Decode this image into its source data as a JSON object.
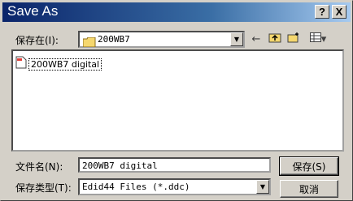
{
  "window": {
    "title": "Save As"
  },
  "titlebar_buttons": {
    "help": "?",
    "close": "X"
  },
  "save_in": {
    "label": "保存在(I):",
    "value": "200WB7"
  },
  "file_list": [
    {
      "name": "200WB7 digital",
      "icon": "document-icon"
    }
  ],
  "filename": {
    "label": "文件名(N):",
    "value": "200WB7 digital"
  },
  "filetype": {
    "label": "保存类型(T):",
    "value": "Edid44 Files (*.ddc)"
  },
  "buttons": {
    "save": "保存(S)",
    "cancel": "取消"
  },
  "toolbar": {
    "back": "←",
    "up": "⬆",
    "new_folder": "✱",
    "view_menu": "▾"
  }
}
